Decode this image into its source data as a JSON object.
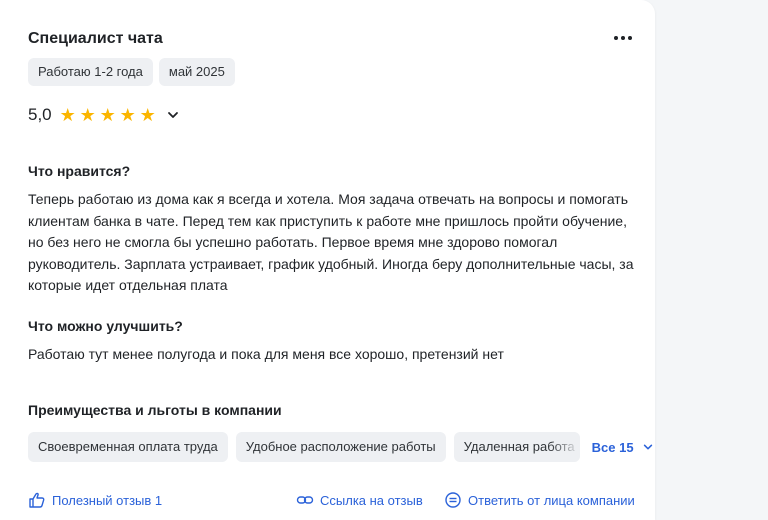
{
  "review": {
    "title": "Специалист чата",
    "tenure_chip": "Работаю 1-2 года",
    "date_chip": "май 2025",
    "rating": "5,0",
    "stars": 5,
    "likes_heading": "Что нравится?",
    "likes_text": "Теперь работаю из дома как я всегда и хотела. Моя задача отвечать на вопросы и помогать клиентам банка в чате. Перед тем как приступить к работе мне пришлось пройти обучение, но без него не смогла бы успешно работать. Первое время мне здорово помогал руководитель. Зарплата устраивает, график удобный. Иногда беру дополнительные часы, за которые идет отдельная плата",
    "improve_heading": "Что можно улучшить?",
    "improve_text": "Работаю тут менее полугода и пока для меня все хорошо, претензий нет",
    "benefits_heading": "Преимущества и льготы в компании",
    "benefits": [
      "Своевременная оплата труда",
      "Удобное расположение работы",
      "Удаленная работа"
    ],
    "benefits_all": "Все 15"
  },
  "footer": {
    "helpful": "Полезный отзыв 1",
    "link": "Ссылка на отзыв",
    "reply": "Ответить от лица компании"
  },
  "colors": {
    "accent": "#2b62d9",
    "star": "#fbb500",
    "chip_bg": "#eef0f3"
  }
}
